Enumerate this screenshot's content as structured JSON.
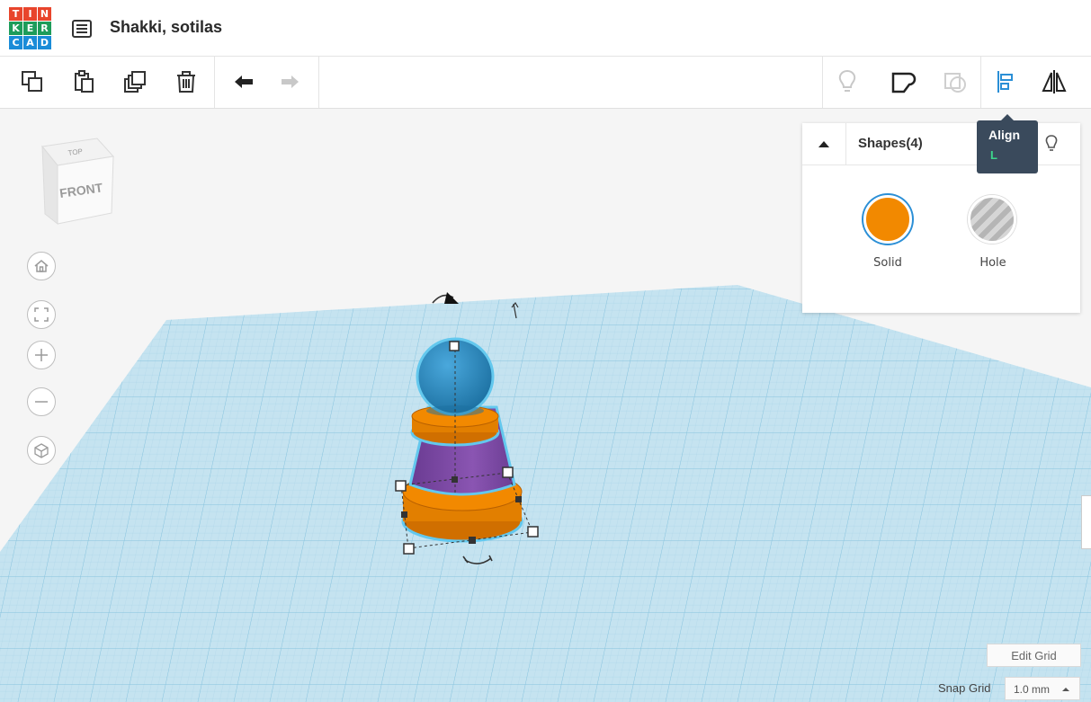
{
  "app": {
    "logo_letters": [
      "T",
      "I",
      "N",
      "K",
      "E",
      "R",
      "C",
      "A",
      "D"
    ],
    "logo_colors": [
      "#e8452c",
      "#e8452c",
      "#e8452c",
      "#1d9c5a",
      "#1d9c5a",
      "#1d9c5a",
      "#1a8cd8",
      "#1a8cd8",
      "#1a8cd8"
    ],
    "design_title": "Shakki, sotilas"
  },
  "toolbar": {
    "left_icons": [
      "copy-icon",
      "paste-icon",
      "duplicate-icon",
      "delete-icon",
      "undo-icon",
      "redo-icon"
    ],
    "right_icons": [
      "lightbulb-icon",
      "group-icon",
      "ungroup-icon",
      "align-icon",
      "mirror-icon"
    ]
  },
  "tooltip": {
    "label": "Align",
    "shortcut": "L"
  },
  "view_cube": {
    "front": "FRONT",
    "top": "TOP"
  },
  "nav_controls": [
    "home-view-icon",
    "fit-view-icon",
    "zoom-in-icon",
    "zoom-out-icon",
    "perspective-icon"
  ],
  "inspector": {
    "title": "Shapes(4)",
    "solid_label": "Solid",
    "hole_label": "Hole",
    "solid_color": "#f28900",
    "hole_color": "#b5b5b5"
  },
  "colors": {
    "grid_plane": "#c5e3f0",
    "sphere": "#2a8ac0",
    "cone": "#7b4aa0",
    "rings": "#f28900",
    "tooltip_bg": "#3a4a5c"
  },
  "grid": {
    "edit_grid_label": "Edit Grid",
    "snap_grid_label": "Snap Grid",
    "snap_grid_value": "1.0 mm"
  }
}
